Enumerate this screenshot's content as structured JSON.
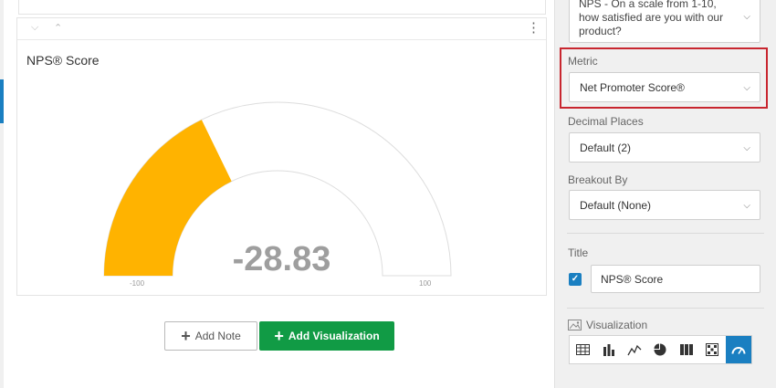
{
  "widget": {
    "title": "NPS® Score",
    "gauge": {
      "value": "-28.83",
      "min_label": "-100",
      "max_label": "100",
      "min": -100,
      "max": 100,
      "score": -28.83,
      "fill_color": "#ffb300",
      "track_color": "#ffffff"
    }
  },
  "actions": {
    "add_note": "Add Note",
    "add_visualization": "Add Visualization"
  },
  "panel": {
    "question_select": "NPS - On a scale from 1-10, how satisfied are you with our product?",
    "metric_label": "Metric",
    "metric_value": "Net Promoter Score®",
    "decimal_label": "Decimal Places",
    "decimal_value": "Default (2)",
    "breakout_label": "Breakout By",
    "breakout_value": "Default (None)",
    "title_label": "Title",
    "title_checked": true,
    "title_value": "NPS® Score",
    "visualization_label": "Visualization",
    "visualization_types": [
      "table-icon",
      "bar-chart-icon",
      "line-chart-icon",
      "pie-chart-icon",
      "breakdown-bar-icon",
      "heatmap-icon",
      "gauge-icon"
    ],
    "active_visualization": "gauge-icon"
  },
  "colors": {
    "accent": "#1a7fc1",
    "primary_button": "#119b45",
    "highlight_border": "#c8262f"
  }
}
